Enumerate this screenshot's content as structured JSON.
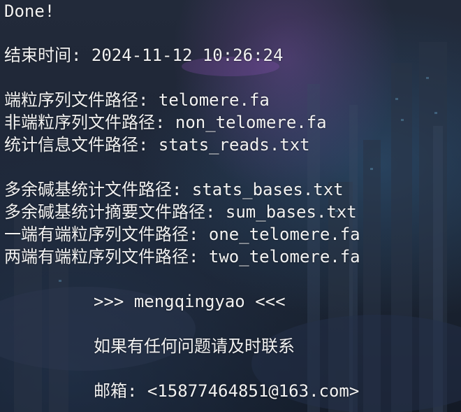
{
  "terminal": {
    "lines": [
      "Done!",
      "结束时间: 2024-11-12 10:26:24",
      "端粒序列文件路径: telomere.fa",
      "非端粒序列文件路径: non_telomere.fa",
      "统计信息文件路径: stats_reads.txt",
      "多余碱基统计文件路径: stats_bases.txt",
      "多余碱基统计摘要文件路径: sum_bases.txt",
      "一端有端粒序列文件路径: one_telomere.fa",
      "两端有端粒序列文件路径: two_telomere.fa",
      ">>> mengqingyao <<<",
      "如果有任何问题请及时联系",
      "邮箱: <15877464851@163.com>"
    ]
  },
  "colors": {
    "text": "#f2f2f2",
    "background": "#1b2233"
  }
}
